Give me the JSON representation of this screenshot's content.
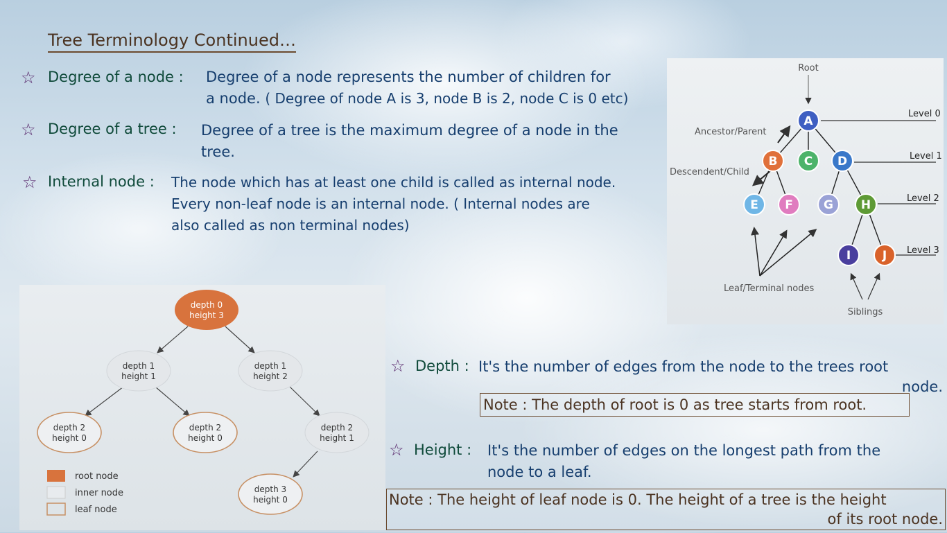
{
  "title": "Tree Terminology Continued…",
  "bullet_icon": "star-outline-icon",
  "items": [
    {
      "term": "Degree of a node :",
      "definition_line1": "Degree of a node represents the number of children for",
      "definition_line2_a": "a node.",
      "definition_line2_b": "( Degree of node A is 3, node B is 2, node C is 0 etc)"
    },
    {
      "term": "Degree of a tree :",
      "definition_line1": "Degree of a tree is the maximum degree of a node in the",
      "definition_line2": "tree."
    },
    {
      "term": "Internal node :",
      "definition_line1": "The node which has at least one child is called as internal node.",
      "definition_line2": "Every non-leaf node is an internal node. ( Internal nodes are",
      "definition_line3": "also called as non terminal nodes)"
    }
  ],
  "depth": {
    "term": "Depth :",
    "definition_line1": "It's the number of edges from the node to the trees root",
    "definition_line2": "node.",
    "note": "Note : The depth of root is 0 as tree starts from root."
  },
  "height": {
    "term": "Height :",
    "definition_line1": "It's the number of edges on the longest path from the",
    "definition_line2": "node to a leaf.",
    "note_line1": "Note : The height of leaf node is 0. The height of a tree is the height",
    "note_line2": "of its root node."
  },
  "tree_diagram": {
    "root_label": "Root",
    "nodes": [
      "A",
      "B",
      "C",
      "D",
      "E",
      "F",
      "G",
      "H",
      "I",
      "J"
    ],
    "levels": [
      "Level 0",
      "Level 1",
      "Level 2",
      "Level 3"
    ],
    "ancestor_label": "Ancestor/Parent",
    "descendent_label": "Descendent/Child",
    "leaf_label": "Leaf/Terminal nodes",
    "siblings_label": "Siblings",
    "colors": {
      "A": "#3f5fc2",
      "B": "#e0703a",
      "C": "#4db36a",
      "D": "#3a78c9",
      "E": "#6fb6e6",
      "F": "#e07cbf",
      "G": "#9aa2d6",
      "H": "#5e9a35",
      "I": "#4a3f9e",
      "J": "#d9622a"
    }
  },
  "depth_diagram": {
    "nodes": [
      {
        "depth": "depth 0",
        "height": "height 3"
      },
      {
        "depth": "depth 1",
        "height": "height 1"
      },
      {
        "depth": "depth 1",
        "height": "height 2"
      },
      {
        "depth": "depth 2",
        "height": "height 0"
      },
      {
        "depth": "depth 2",
        "height": "height 0"
      },
      {
        "depth": "depth 2",
        "height": "height 1"
      },
      {
        "depth": "depth 3",
        "height": "height 0"
      }
    ],
    "legend": [
      "root node",
      "inner node",
      "leaf node"
    ],
    "colors": {
      "root": "#d8733d",
      "inner": "#e4e7ea",
      "leaf_border": "#c79064"
    }
  }
}
